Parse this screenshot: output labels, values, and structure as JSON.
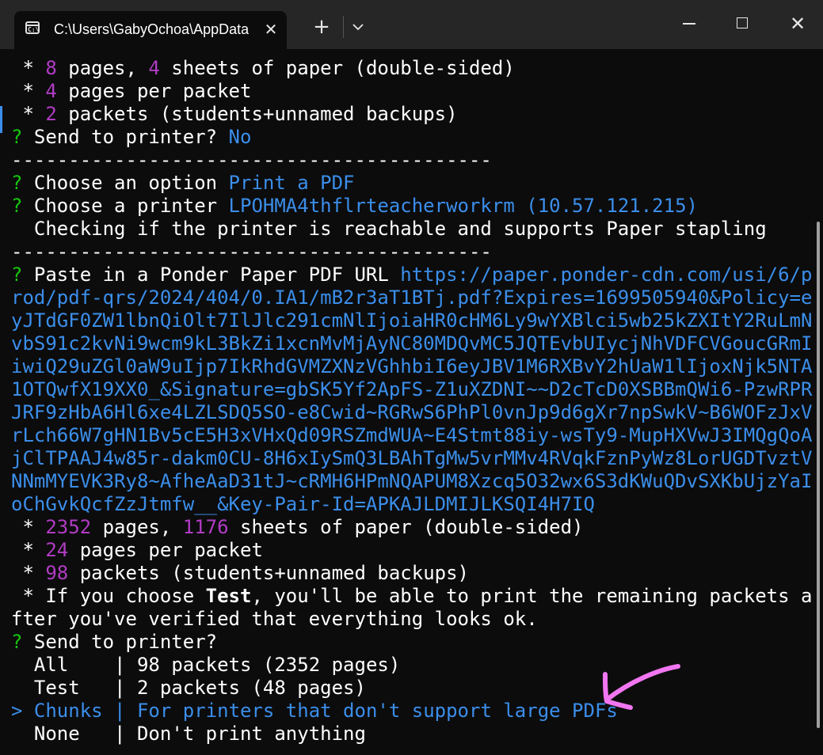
{
  "window": {
    "tab_title": "C:\\Users\\GabyOchoa\\AppData",
    "tab_icon_text": "C:\\",
    "close_tab": "✕",
    "new_tab": "+",
    "close_window": "✕"
  },
  "terminal": {
    "l1": {
      "a": " * ",
      "b": "8",
      "c": " pages, ",
      "d": "4",
      "e": " sheets of paper (double-sided)"
    },
    "l2": {
      "a": " * ",
      "b": "4",
      "c": " pages per packet"
    },
    "l3": {
      "a": " * ",
      "b": "2",
      "c": " packets (students+unnamed backups)"
    },
    "l4": {
      "a": "?",
      "b": " Send to printer? ",
      "c": "No"
    },
    "l5": "------------------------------------------",
    "l6": {
      "a": "?",
      "b": " Choose an option ",
      "c": "Print a PDF"
    },
    "l7": {
      "a": "?",
      "b": " Choose a printer ",
      "c": "LPOHMA4thflrteacherworkrm (10.57.121.215)"
    },
    "l8": "  Checking if the printer is reachable and supports Paper stapling",
    "l9": "------------------------------------------",
    "l10": {
      "a": "?",
      "b": " Paste in a Ponder Paper PDF URL ",
      "c": "https://paper.ponder-cdn.com/usi/6/p"
    },
    "url_lines": [
      "rod/pdf-qrs/2024/404/0.IA1/mB2r3aT1BTj.pdf?Expires=1699505940&Policy=e",
      "yJTdGF0ZW1lbnQiOlt7IlJlc291cmNlIjoiaHR0cHM6Ly9wYXBlci5wb25kZXItY2RuLmN",
      "vbS91c2kvNi9wcm9kL3BkZi1xcnMvMjAyNC80MDQvMC5JQTEvbUIycjNhVDFCVGoucGRmI",
      "iwiQ29uZGl0aW9uIjp7IkRhdGVMZXNzVGhhbiI6eyJBV1M6RXBvY2hUaW1lIjoxNjk5NTA",
      "1OTQwfX19XX0_&Signature=gbSK5Yf2ApFS-Z1uXZDNI~~D2cTcD0XSBBmQWi6-PzwRPR",
      "JRF9zHbA6Hl6xe4LZLSDQ5SO-e8Cwid~RGRwS6PhPl0vnJp9d6gXr7npSwkV~B6WOFzJxV",
      "rLch66W7gHN1Bv5cE5H3xVHxQd09RSZmdWUA~E4Stmt88iy-wsTy9-MupHXVwJ3IMQgQoA",
      "jClTPAAJ4w85r-dakm0CU-8H6xIySmQ3LBAhTgMw5vrMMv4RVqkFznPyWz8LorUGDTvztV",
      "NNmMYEVK3Ry8~AfheAaD31tJ~cRMH6HPmNQAPUM8Xzcq5O32wx6S3dKWuQDvSXKbUjzYaI",
      "oChGvkQcfZzJtmfw__&Key-Pair-Id=APKAJLDMIJLKSQI4H7IQ"
    ],
    "l21": {
      "a": " * ",
      "b": "2352",
      "c": " pages, ",
      "d": "1176",
      "e": " sheets of paper (double-sided)"
    },
    "l22": {
      "a": " * ",
      "b": "24",
      "c": " pages per packet"
    },
    "l23": {
      "a": " * ",
      "b": "98",
      "c": " packets (students+unnamed backups)"
    },
    "l24": {
      "a": " * If you choose ",
      "b": "Test",
      "c": ", you'll be able to print the remaining packets a"
    },
    "l25": "fter you've verified that everything looks ok.",
    "l26": {
      "a": "?",
      "b": " Send to printer?"
    },
    "options": [
      {
        "marker": "  ",
        "name": "All   ",
        "sep": " | ",
        "desc": "98 packets (2352 pages)"
      },
      {
        "marker": "  ",
        "name": "Test  ",
        "sep": " | ",
        "desc": "2 packets (48 pages)"
      },
      {
        "marker": "> ",
        "name": "Chunks",
        "sep": " | ",
        "desc": "For printers that don't support large PDFs"
      },
      {
        "marker": "  ",
        "name": "None  ",
        "sep": " | ",
        "desc": "Don't print anything"
      }
    ],
    "selected_option": "Chunks"
  },
  "colors": {
    "background": "#0c0c0c",
    "titlebar": "#262626",
    "number_purple": "#b13cc4",
    "prompt_green": "#16c60c",
    "answer_blue": "#3b8eea",
    "annotation_arrow": "#f276f2"
  },
  "icons": [
    "terminal-icon",
    "close-icon",
    "plus-icon",
    "chevron-down-icon",
    "minimize-icon",
    "maximize-icon",
    "annotation-arrow-icon"
  ]
}
